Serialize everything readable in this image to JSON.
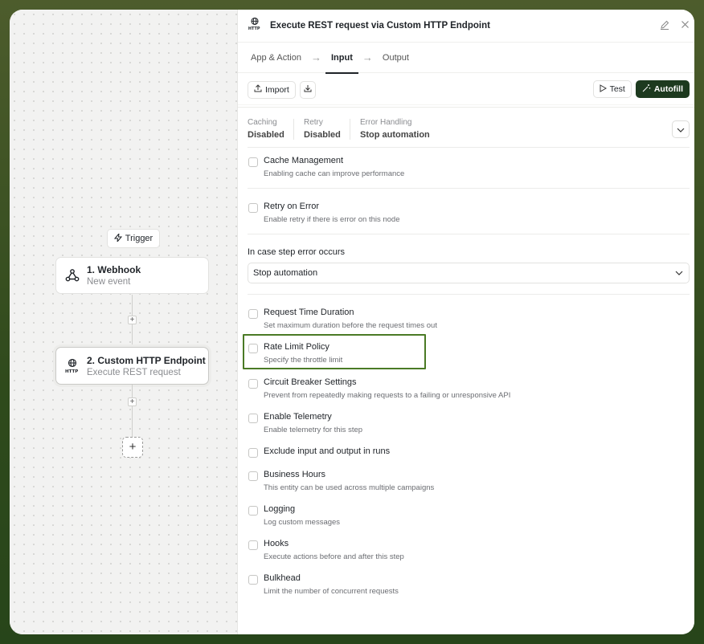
{
  "canvas": {
    "trigger_label": "Trigger",
    "nodes": [
      {
        "title": "1. Webhook",
        "subtitle": "New event"
      },
      {
        "title": "2. Custom HTTP Endpoint",
        "subtitle": "Execute REST request"
      }
    ]
  },
  "panel": {
    "title": "Execute REST request via Custom HTTP Endpoint",
    "tabs": [
      "App & Action",
      "Input",
      "Output"
    ],
    "active_tab": "Input",
    "toolbar": {
      "import_label": "Import",
      "test_label": "Test",
      "autofill_label": "Autofill"
    },
    "summary": [
      {
        "label": "Caching",
        "value": "Disabled"
      },
      {
        "label": "Retry",
        "value": "Disabled"
      },
      {
        "label": "Error Handling",
        "value": "Stop automation"
      }
    ],
    "options": [
      {
        "title": "Cache Management",
        "desc": "Enabling cache can improve performance"
      },
      {
        "title": "Retry on Error",
        "desc": "Enable retry if there is error on this node"
      },
      {
        "title": "Request Time Duration",
        "desc": "Set maximum duration before the request times out"
      },
      {
        "title": "Rate Limit Policy",
        "desc": "Specify the throttle limit"
      },
      {
        "title": "Circuit Breaker Settings",
        "desc": "Prevent from repeatedly making requests to a failing or unresponsive API"
      },
      {
        "title": "Enable Telemetry",
        "desc": "Enable telemetry for this step"
      },
      {
        "title": "Exclude input and output in runs",
        "desc": ""
      },
      {
        "title": "Business Hours",
        "desc": "This entity can be used across multiple campaigns"
      },
      {
        "title": "Logging",
        "desc": "Log custom messages"
      },
      {
        "title": "Hooks",
        "desc": "Execute actions before and after this step"
      },
      {
        "title": "Bulkhead",
        "desc": "Limit the number of concurrent requests"
      }
    ],
    "error_section": {
      "label": "In case step error occurs",
      "selected": "Stop automation"
    }
  },
  "colors": {
    "accent_dark": "#1d3a1f",
    "highlight": "#4a7a25",
    "frame": "#3a5223"
  },
  "icons": [
    "lightning-icon",
    "webhook-icon",
    "http-globe-icon",
    "pencil-icon",
    "close-icon",
    "arrow-right-icon",
    "upload-icon",
    "download-icon",
    "play-icon",
    "magic-wand-icon",
    "chevron-down-icon",
    "plus-icon"
  ]
}
